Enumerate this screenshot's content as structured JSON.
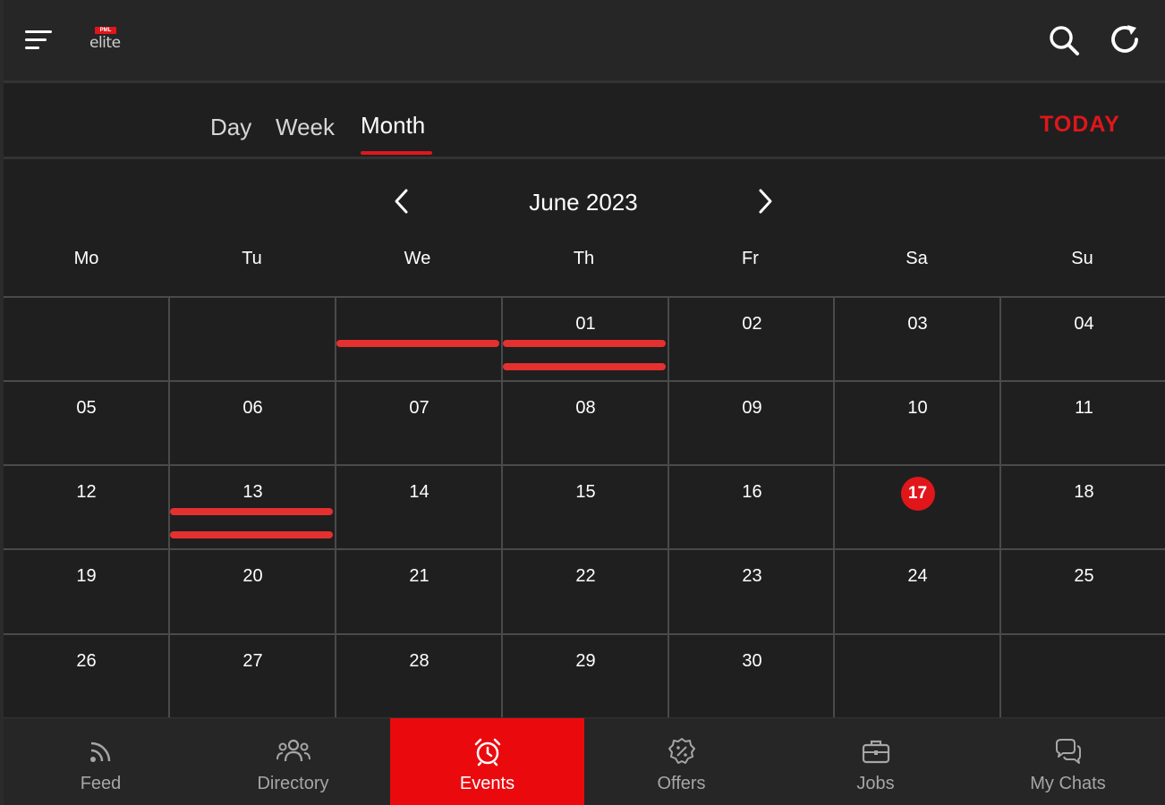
{
  "header": {
    "logo_badge": "PML",
    "logo_text": "elite"
  },
  "view_tabs": [
    {
      "label": "Day",
      "active": false
    },
    {
      "label": "Week",
      "active": false
    },
    {
      "label": "Month",
      "active": true
    }
  ],
  "today_label": "TODAY",
  "month_title": "June 2023",
  "weekdays": [
    "Mo",
    "Tu",
    "We",
    "Th",
    "Fr",
    "Sa",
    "Su"
  ],
  "weeks": [
    [
      "",
      "",
      "",
      "01",
      "02",
      "03",
      "04"
    ],
    [
      "05",
      "06",
      "07",
      "08",
      "09",
      "10",
      "11"
    ],
    [
      "12",
      "13",
      "14",
      "15",
      "16",
      "17",
      "18"
    ],
    [
      "19",
      "20",
      "21",
      "22",
      "23",
      "24",
      "25"
    ],
    [
      "26",
      "27",
      "28",
      "29",
      "30",
      "",
      ""
    ]
  ],
  "today_day": "17",
  "bottom_nav": [
    {
      "label": "Feed",
      "icon": "rss-icon",
      "active": false
    },
    {
      "label": "Directory",
      "icon": "users-icon",
      "active": false
    },
    {
      "label": "Events",
      "icon": "alarm-clock-icon",
      "active": true
    },
    {
      "label": "Offers",
      "icon": "discount-badge-icon",
      "active": false
    },
    {
      "label": "Jobs",
      "icon": "briefcase-icon",
      "active": false
    },
    {
      "label": "My Chats",
      "icon": "chat-bubbles-icon",
      "active": false
    }
  ],
  "colors": {
    "accent": "#e0161b",
    "background": "#1f1f1f",
    "header": "#262626",
    "event_bar": "#e53030"
  }
}
